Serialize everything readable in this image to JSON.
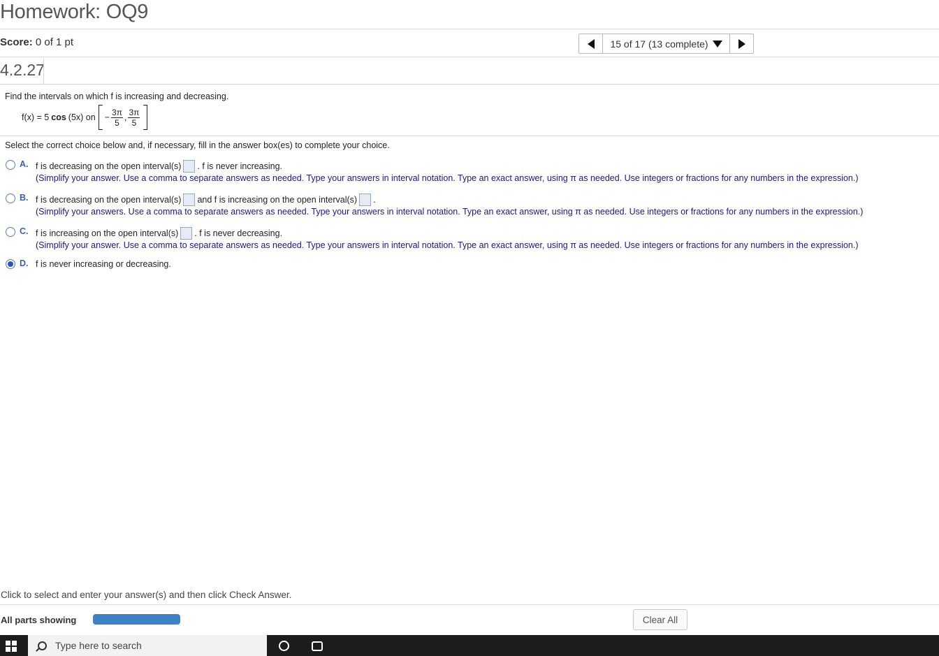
{
  "header": {
    "title": "Homework: OQ9",
    "score_label": "Score:",
    "score_value": "0 of 1 pt",
    "nav_label": "15 of 17 (13 complete)",
    "question_number": "4.2.27"
  },
  "question": {
    "prompt": "Find the intervals on which f is increasing and decreasing.",
    "func_left": "f(x) = 5",
    "func_cos": "cos",
    "func_arg": "(5x) on",
    "interval_minus": "−",
    "interval_num1": "3π",
    "interval_den1": "5",
    "interval_comma": ",",
    "interval_num2": "3π",
    "interval_den2": "5"
  },
  "instructions": "Select the correct choice below and, if necessary, fill in the answer box(es) to complete your choice.",
  "choices": [
    {
      "letter": "A.",
      "text_before": "f is decreasing on the open interval(s)",
      "text_after": ". f is never increasing.",
      "hint": "(Simplify your answer. Use a comma to separate answers as needed. Type your answers in interval notation. Type an exact answer, using π as needed. Use integers or fractions for any numbers in the expression.)"
    },
    {
      "letter": "B.",
      "text_before": "f is decreasing on the open interval(s)",
      "text_middle": "and f is increasing on the open interval(s)",
      "text_after": ".",
      "hint": "(Simplify your answers. Use a comma to separate answers as needed. Type your answers in interval notation. Type an exact answer, using π as needed. Use integers or fractions for any numbers in the expression.)"
    },
    {
      "letter": "C.",
      "text_before": "f is increasing on the open interval(s)",
      "text_after": ". f is never decreasing.",
      "hint": "(Simplify your answer. Use a comma to separate answers as needed. Type your answers in interval notation. Type an exact answer, using π as needed. Use integers or fractions for any numbers in the expression.)"
    },
    {
      "letter": "D.",
      "text_before": "f is never increasing or decreasing.",
      "selected": true
    }
  ],
  "footer": {
    "hint": "Click to select and enter your answer(s) and then click Check Answer.",
    "parts_label": "All parts showing",
    "clear_label": "Clear All",
    "progress_color": "#3b82c8"
  },
  "taskbar": {
    "search_placeholder": "Type here to search",
    "icons": [
      "windows-start-icon",
      "search-icon",
      "cortana-icon",
      "task-view-icon"
    ]
  }
}
